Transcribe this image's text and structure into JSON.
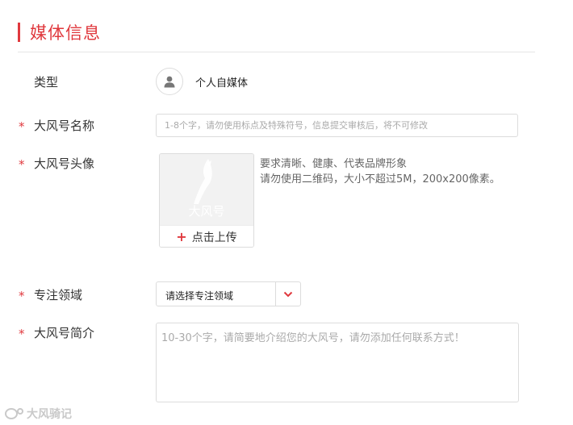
{
  "section": {
    "title": "媒体信息"
  },
  "form": {
    "type": {
      "label": "类型",
      "value": "个人自媒体"
    },
    "name": {
      "label": "大风号名称",
      "placeholder": "1-8个字，请勿使用标点及特殊符号，信息提交审核后，将不可修改"
    },
    "avatar": {
      "label": "大风号头像",
      "preview_logo_text": "大风号",
      "upload_label": "点击上传",
      "hint_line1": "要求清晰、健康、代表品牌形象",
      "hint_line2": "请勿使用二维码，大小不超过5M，200x200像素。"
    },
    "field": {
      "label": "专注领域",
      "selected": "请选择专注领域"
    },
    "intro": {
      "label": "大风号简介",
      "placeholder": "10-30个字，请简要地介绍您的大风号，请勿添加任何联系方式！"
    },
    "required_mark": "*"
  },
  "watermark": {
    "text": "大风骑记"
  },
  "colors": {
    "accent": "#e0393e",
    "border": "#dcdcdc",
    "placeholder": "#aaaaaa"
  },
  "icons": [
    "user-icon",
    "chevron-down-icon",
    "plus-icon"
  ]
}
